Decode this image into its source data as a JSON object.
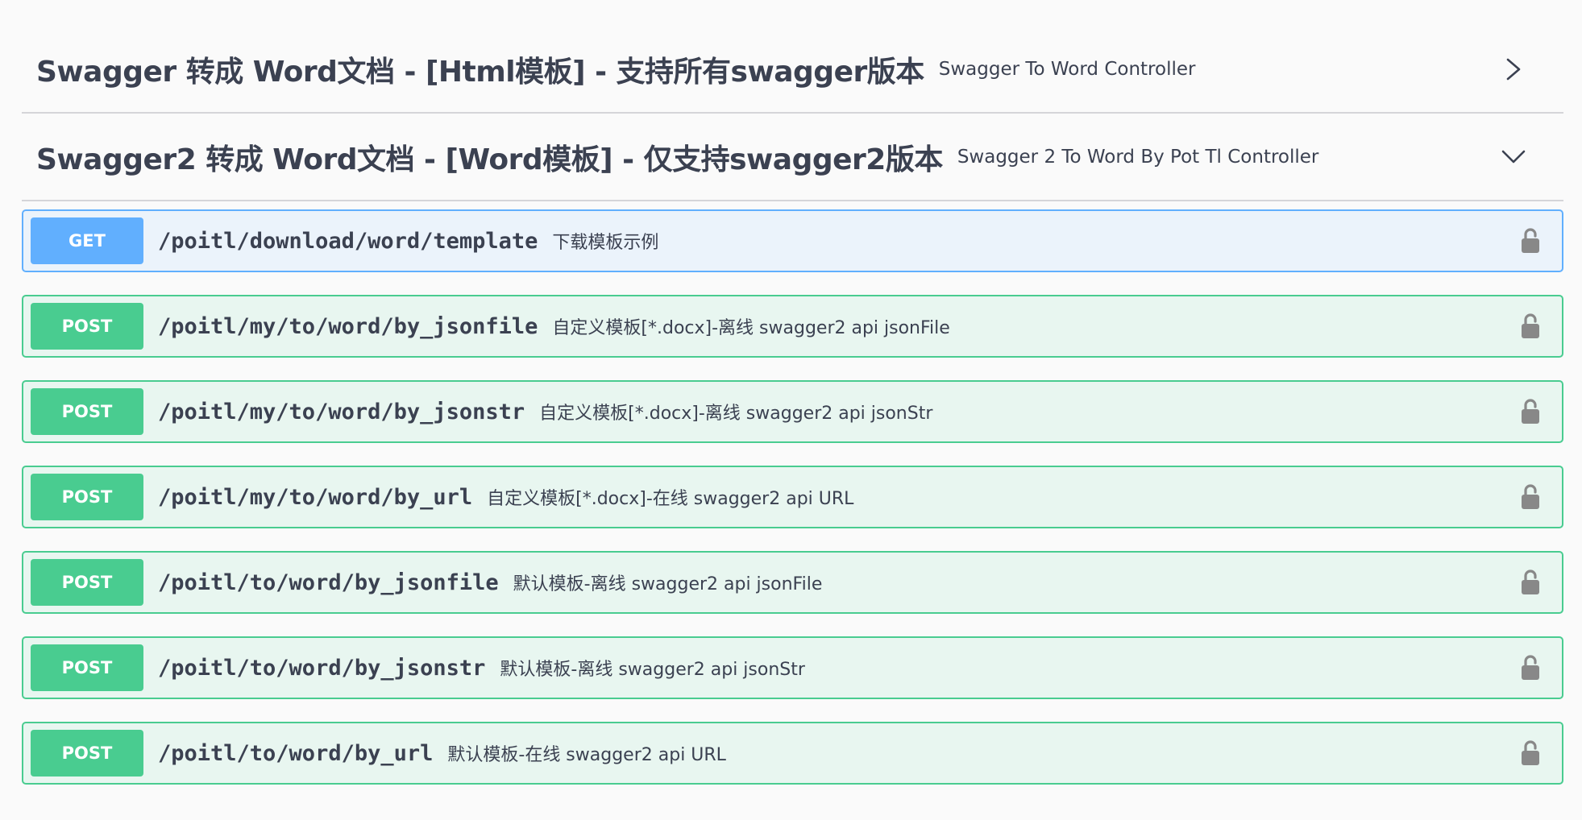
{
  "tags": [
    {
      "title": "Swagger 转成 Word文档 - [Html模板] - 支持所有swagger版本",
      "description": "Swagger To Word Controller",
      "expanded": false,
      "chevron_icon": "chevron-right-icon"
    },
    {
      "title": "Swagger2 转成 Word文档 - [Word模板] - 仅支持swagger2版本",
      "description": "Swagger 2 To Word By Pot Tl Controller",
      "expanded": true,
      "chevron_icon": "chevron-down-icon"
    }
  ],
  "operations": [
    {
      "method": "GET",
      "path": "/poitl/download/word/template",
      "summary": "下载模板示例"
    },
    {
      "method": "POST",
      "path": "/poitl/my/to/word/by_jsonfile",
      "summary": "自定义模板[*.docx]-离线 swagger2 api jsonFile"
    },
    {
      "method": "POST",
      "path": "/poitl/my/to/word/by_jsonstr",
      "summary": "自定义模板[*.docx]-离线 swagger2 api jsonStr"
    },
    {
      "method": "POST",
      "path": "/poitl/my/to/word/by_url",
      "summary": "自定义模板[*.docx]-在线 swagger2 api URL"
    },
    {
      "method": "POST",
      "path": "/poitl/to/word/by_jsonfile",
      "summary": "默认模板-离线 swagger2 api jsonFile"
    },
    {
      "method": "POST",
      "path": "/poitl/to/word/by_jsonstr",
      "summary": "默认模板-离线 swagger2 api jsonStr"
    },
    {
      "method": "POST",
      "path": "/poitl/to/word/by_url",
      "summary": "默认模板-在线 swagger2 api URL"
    }
  ],
  "colors": {
    "get": "#61affe",
    "post": "#49cc90",
    "text": "#3b4151",
    "lock": "#888888"
  }
}
